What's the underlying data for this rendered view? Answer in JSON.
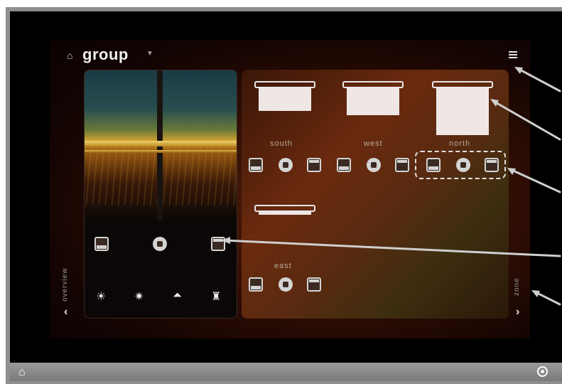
{
  "header": {
    "home_icon": "home-icon",
    "group_label": "group",
    "dropdown_icon": "caret-down-icon",
    "menu_icon": "hamburger-menu-icon"
  },
  "scene_panel": {
    "controls": [
      "open-icon",
      "stop-icon",
      "close-icon"
    ],
    "scene_icons": [
      "sunrise-icon",
      "sunset-icon",
      "dining-icon",
      "wine-icon"
    ],
    "nav_label": "overview",
    "nav_arrow": "‹"
  },
  "zones": [
    {
      "label": "south",
      "shade_level": 0.45
    },
    {
      "label": "west",
      "shade_level": 0.55
    },
    {
      "label": "north",
      "shade_level": 1.0
    },
    {
      "label": "east",
      "shade_level": 0.05
    }
  ],
  "zone_nav": {
    "label": "zone",
    "arrow": "›"
  },
  "bottom_bar": {
    "home_icon": "home-icon",
    "settings_icon": "target-icon"
  },
  "colors": {
    "background": "#000000",
    "bezel": "#8f8f8f",
    "accent": "#e8e8e8",
    "bar": "#8a8a8a"
  }
}
